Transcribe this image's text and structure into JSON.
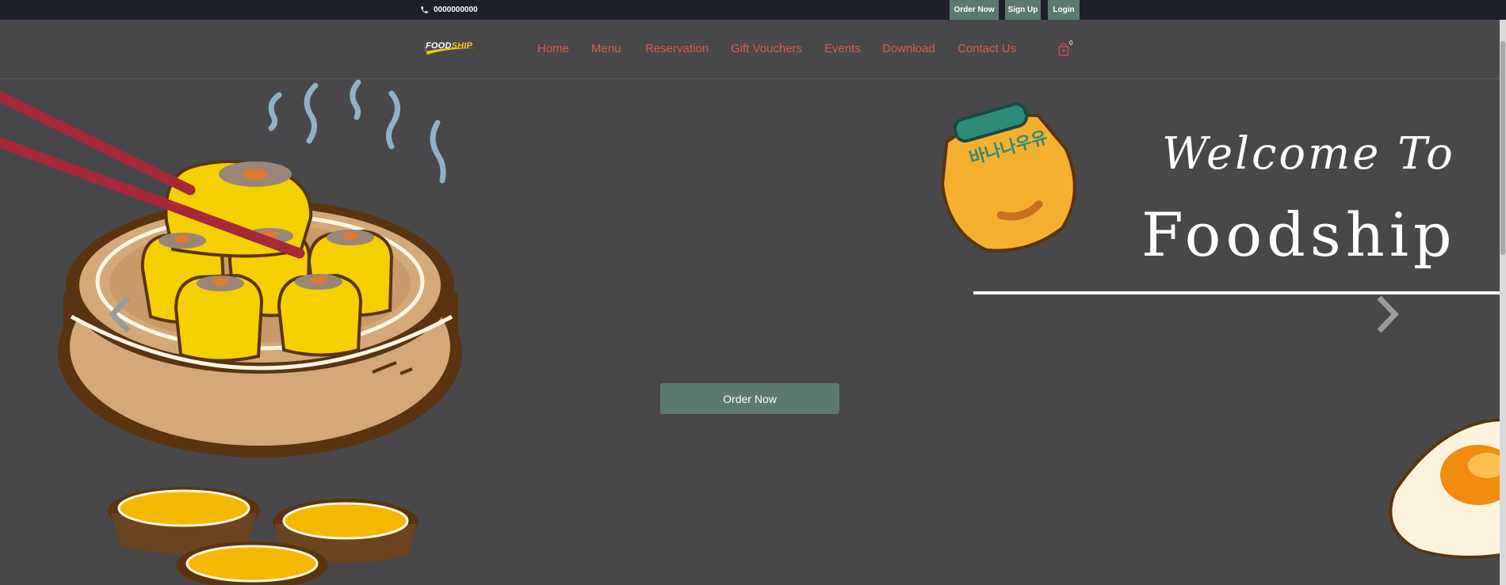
{
  "topbar": {
    "phone": "0000000000",
    "order_now": "Order Now",
    "sign_up": "Sign Up",
    "login": "Login"
  },
  "brand": {
    "name_part1": "FOOD",
    "name_part2": "SHIP"
  },
  "nav": {
    "items": [
      "Home",
      "Menu",
      "Reservation",
      "Gift Vouchers",
      "Events",
      "Download",
      "Contact Us"
    ],
    "cart_count": "0"
  },
  "hero": {
    "welcome_line1": "Welcome To",
    "welcome_line2": "Foodship",
    "order_button": "Order Now",
    "milk_label": "바나나우유"
  },
  "colors": {
    "topbar_bg": "#1c2029",
    "page_bg": "#48484a",
    "accent_button": "#5b7a6f",
    "nav_link": "#d06050",
    "brand_yellow": "#f5c518"
  }
}
